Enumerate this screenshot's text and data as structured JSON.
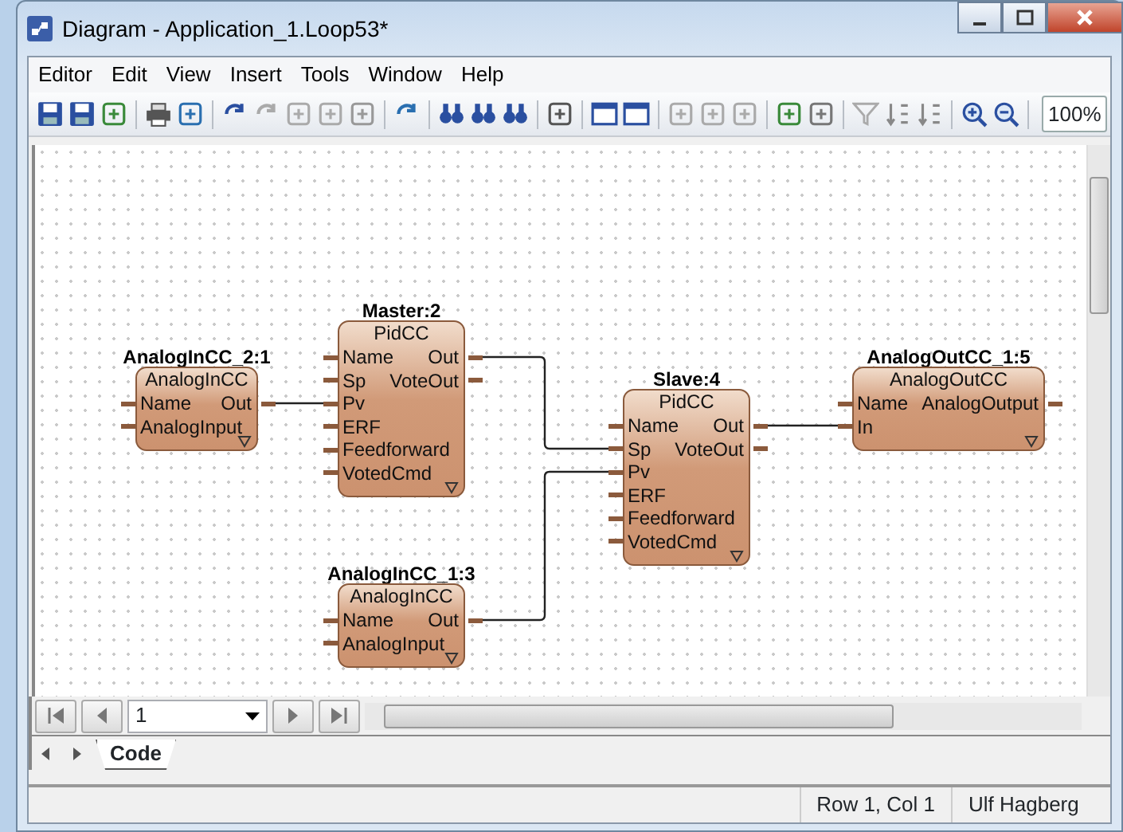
{
  "window": {
    "title": "Diagram - Application_1.Loop53*"
  },
  "menu": [
    {
      "label": "Editor"
    },
    {
      "label": "Edit"
    },
    {
      "label": "View"
    },
    {
      "label": "Insert"
    },
    {
      "label": "Tools"
    },
    {
      "label": "Window"
    },
    {
      "label": "Help"
    }
  ],
  "toolbar": {
    "zoom": "100%"
  },
  "diagram": {
    "blocks": [
      {
        "name": "AnalogInCC_2:1",
        "type": "AnalogInCC",
        "inputs": [
          "Name",
          "AnalogInput"
        ],
        "outputs": [
          "Out"
        ]
      },
      {
        "name": "Master:2",
        "type": "PidCC",
        "inputs": [
          "Name",
          "Sp",
          "Pv",
          "ERF",
          "Feedforward",
          "VotedCmd"
        ],
        "outputs": [
          "Out",
          "VoteOut"
        ]
      },
      {
        "name": "AnalogInCC_1:3",
        "type": "AnalogInCC",
        "inputs": [
          "Name",
          "AnalogInput"
        ],
        "outputs": [
          "Out"
        ]
      },
      {
        "name": "Slave:4",
        "type": "PidCC",
        "inputs": [
          "Name",
          "Sp",
          "Pv",
          "ERF",
          "Feedforward",
          "VotedCmd"
        ],
        "outputs": [
          "Out",
          "VoteOut"
        ]
      },
      {
        "name": "AnalogOutCC_1:5",
        "type": "AnalogOutCC",
        "inputs": [
          "Name",
          "In"
        ],
        "outputs": [
          "AnalogOutput"
        ]
      }
    ]
  },
  "page_navigator": {
    "value": "1"
  },
  "tabs": [
    {
      "label": "Code",
      "selected": true
    }
  ],
  "status_bar": {
    "position": "Row 1, Col 1",
    "user": "Ulf Hagberg"
  }
}
